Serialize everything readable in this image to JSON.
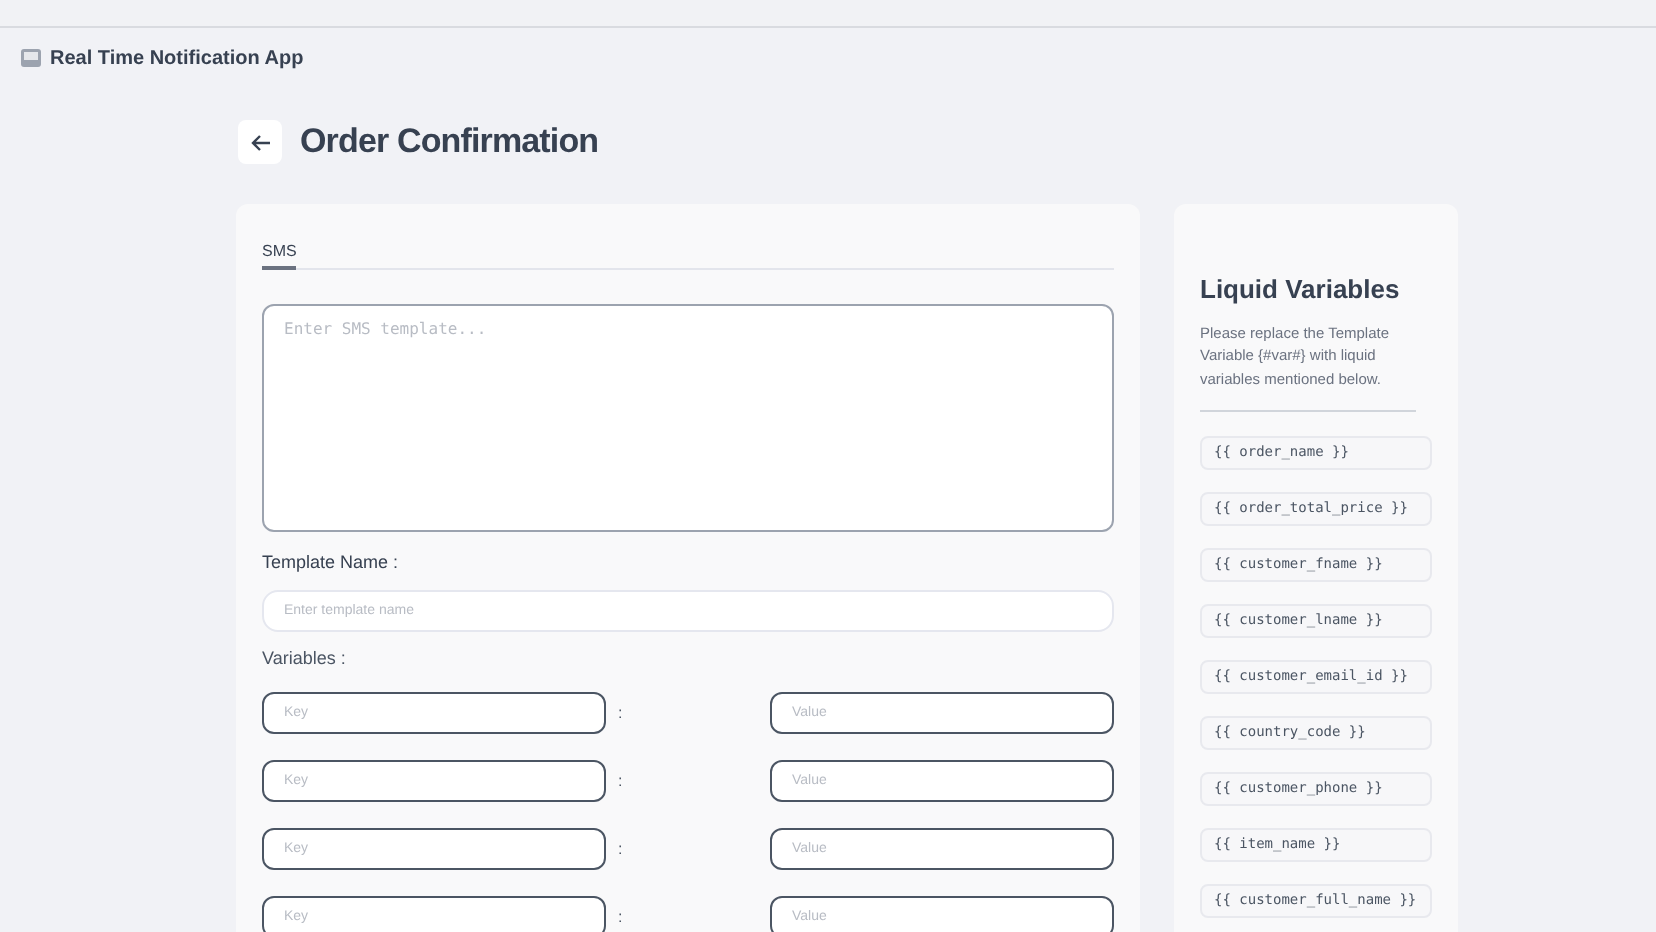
{
  "app": {
    "title": "Real Time Notification App"
  },
  "page": {
    "title": "Order Confirmation"
  },
  "tabs": [
    {
      "label": "SMS",
      "selected": true
    }
  ],
  "template": {
    "placeholder": "Enter SMS template..."
  },
  "template_name": {
    "label": "Template Name :",
    "placeholder": "Enter template name"
  },
  "variables": {
    "label": "Variables :",
    "rows": [
      {
        "key_placeholder": "Key",
        "separator": ":",
        "value_placeholder": "Value"
      },
      {
        "key_placeholder": "Key",
        "separator": ":",
        "value_placeholder": "Value"
      },
      {
        "key_placeholder": "Key",
        "separator": ":",
        "value_placeholder": "Value"
      },
      {
        "key_placeholder": "Key",
        "separator": ":",
        "value_placeholder": "Value"
      }
    ]
  },
  "liquid": {
    "title": "Liquid Variables",
    "description": "Please replace the Template Variable {#var#} with liquid variables mentioned below.",
    "items": [
      "{{ order_name }}",
      "{{ order_total_price }}",
      "{{ customer_fname }}",
      "{{ customer_lname }}",
      "{{ customer_email_id }}",
      "{{ country_code }}",
      "{{ customer_phone }}",
      "{{ item_name }}",
      "{{ customer_full_name }}"
    ]
  }
}
